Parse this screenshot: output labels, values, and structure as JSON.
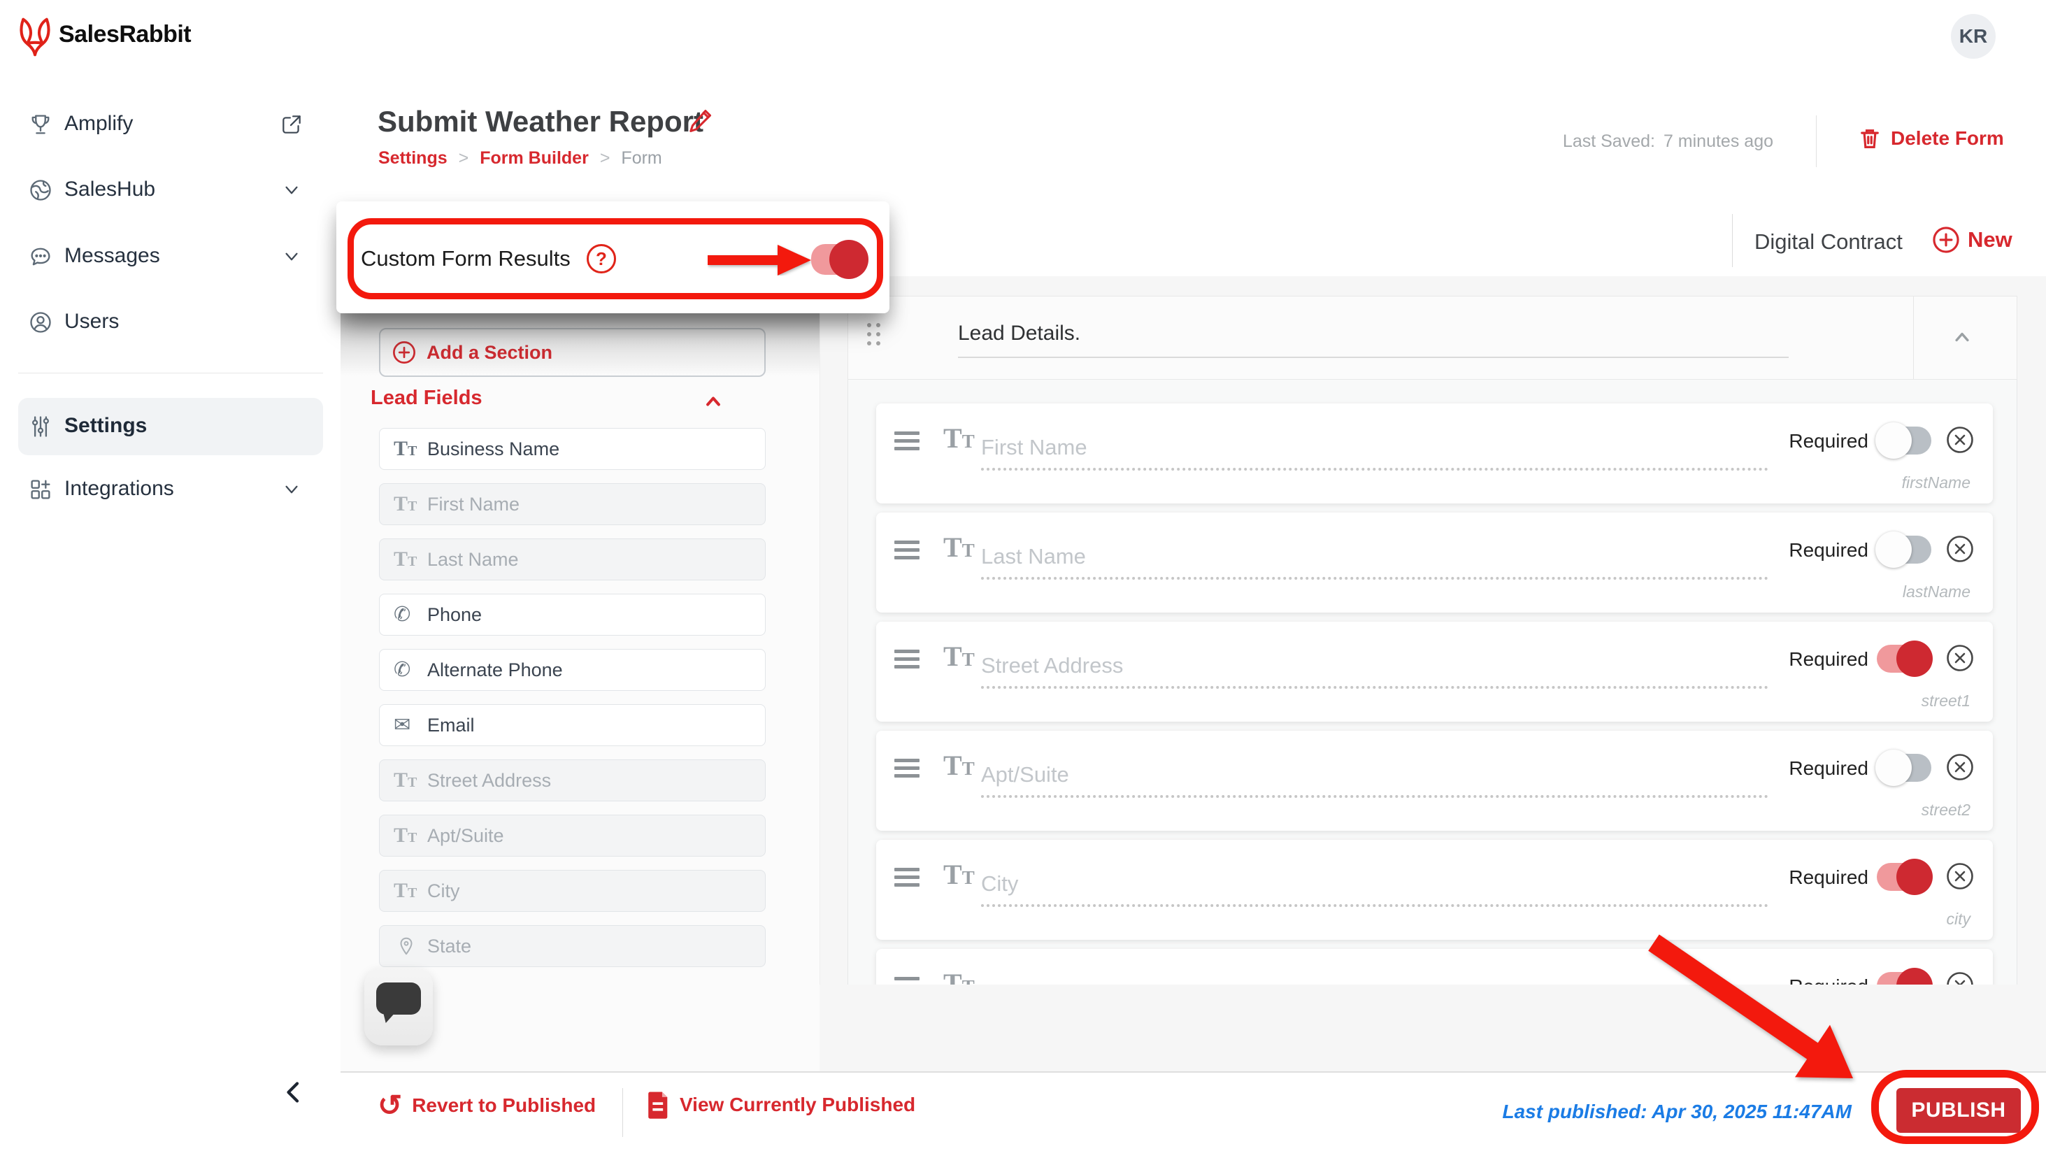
{
  "app": {
    "brand": "SalesRabbit",
    "avatar_initials": "KR"
  },
  "sidebar": {
    "items": [
      {
        "label": "Amplify",
        "icon": "trophy-icon",
        "trailing": "external-link-icon",
        "active": false
      },
      {
        "label": "SalesHub",
        "icon": "globe-icon",
        "trailing": "chevron-down-icon",
        "active": false
      },
      {
        "label": "Messages",
        "icon": "chat-icon",
        "trailing": "chevron-down-icon",
        "active": false
      },
      {
        "label": "Users",
        "icon": "user-icon",
        "trailing": "",
        "active": false
      },
      {
        "label": "Settings",
        "icon": "sliders-icon",
        "trailing": "",
        "active": true
      },
      {
        "label": "Integrations",
        "icon": "grid-plus-icon",
        "trailing": "chevron-down-icon",
        "active": false
      }
    ]
  },
  "page": {
    "title": "Submit Weather Report",
    "breadcrumbs": [
      "Settings",
      "Form Builder",
      "Form"
    ],
    "last_saved_label": "Last Saved:",
    "last_saved_value": "7 minutes ago",
    "delete_form": "Delete Form"
  },
  "tabs": {
    "digital_contract": "Digital Contract",
    "new": "New"
  },
  "callout": {
    "title": "Custom Form Results",
    "help": "?"
  },
  "builder": {
    "add_section": "Add a Section",
    "group_title": "Lead Fields",
    "fields": [
      {
        "label": "Business Name",
        "icon": "text-icon",
        "enabled": true
      },
      {
        "label": "First Name",
        "icon": "text-icon",
        "enabled": false
      },
      {
        "label": "Last Name",
        "icon": "text-icon",
        "enabled": false
      },
      {
        "label": "Phone",
        "icon": "phone-icon",
        "enabled": true
      },
      {
        "label": "Alternate Phone",
        "icon": "phone-icon",
        "enabled": true
      },
      {
        "label": "Email",
        "icon": "envelope-icon",
        "enabled": true
      },
      {
        "label": "Street Address",
        "icon": "text-icon",
        "enabled": false
      },
      {
        "label": "Apt/Suite",
        "icon": "text-icon",
        "enabled": false
      },
      {
        "label": "City",
        "icon": "text-icon",
        "enabled": false
      },
      {
        "label": "State",
        "icon": "pin-icon",
        "enabled": false
      }
    ]
  },
  "canvas": {
    "section_title": "Lead Details.",
    "required_label": "Required",
    "rows": [
      {
        "placeholder": "First Name",
        "key": "firstName",
        "required": false,
        "partial": false
      },
      {
        "placeholder": "Last Name",
        "key": "lastName",
        "required": false,
        "partial": false
      },
      {
        "placeholder": "Street Address",
        "key": "street1",
        "required": true,
        "partial": false
      },
      {
        "placeholder": "Apt/Suite",
        "key": "street2",
        "required": false,
        "partial": false
      },
      {
        "placeholder": "City",
        "key": "city",
        "required": true,
        "partial": false
      },
      {
        "placeholder": "",
        "key": "",
        "required": true,
        "partial": true
      }
    ]
  },
  "footer": {
    "revert": "Revert to Published",
    "view": "View Currently Published",
    "last_published": "Last published: Apr 30, 2025 11:47AM",
    "publish": "PUBLISH"
  },
  "colors": {
    "brand_red": "#d7282e",
    "annotation_red": "#f3190d",
    "link_blue": "#1b7ce5",
    "toggle_on_knob": "#ce2931",
    "toggle_on_track": "#f0999c",
    "toggle_off_track": "#b9bfc5"
  }
}
